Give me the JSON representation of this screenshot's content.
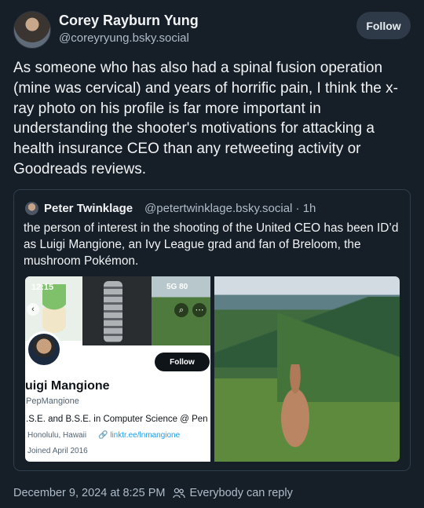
{
  "author": {
    "name": "Corey Rayburn Yung",
    "handle": "@coreyryung.bsky.social",
    "follow_label": "Follow"
  },
  "post": {
    "text": "As someone who has also had a spinal fusion operation (mine was cervical) and years of horrific pain, I think the x-ray photo on his profile is far more important in understanding the shooter's motivations for attacking a health insurance CEO than any retweeting activity or Goodreads reviews."
  },
  "quote": {
    "name": "Peter Twinklage",
    "handle": "@petertwinklage.bsky.social · 1h",
    "text": "the person of interest in the shooting of the United CEO has been ID’d as Luigi Mangione, an Ivy League grad and fan of Breloom, the mushroom Pokémon.",
    "screenshot": {
      "status_time": "12:15",
      "status_signal": "5G 80",
      "follow_label": "Follow",
      "name": "uigi Mangione",
      "handle": "PepMangione",
      "bio": ".S.E. and B.S.E. in Computer Science @ Pen",
      "location": "Honolulu, Hawaii",
      "link": "linktr.ee/lnmangione",
      "joined": "Joined April 2016"
    }
  },
  "meta": {
    "timestamp": "December 9, 2024 at 8:25 PM",
    "reply_setting": "Everybody can reply"
  },
  "colors": {
    "background": "#161e27",
    "muted_text": "#aebbc9",
    "card_border": "#2f3d4c",
    "button_bg": "#2e3a47"
  }
}
